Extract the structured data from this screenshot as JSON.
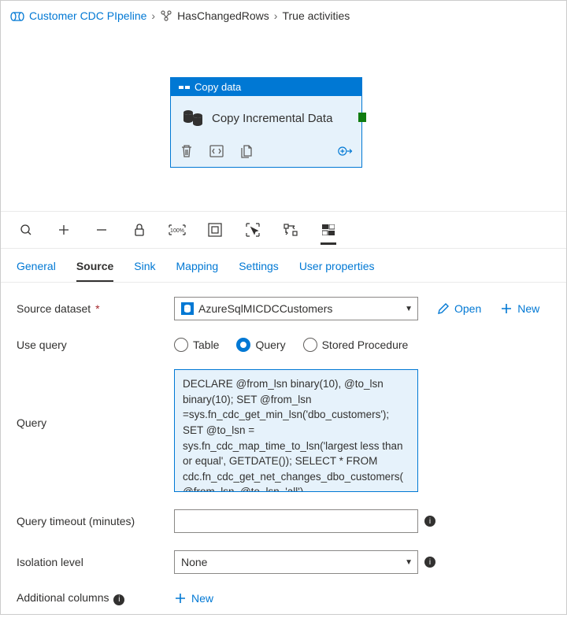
{
  "breadcrumb": {
    "root": "Customer CDC PIpeline",
    "mid": "HasChangedRows",
    "leaf": "True activities"
  },
  "activity": {
    "header": "Copy data",
    "title": "Copy Incremental Data"
  },
  "tabs": {
    "general": "General",
    "source": "Source",
    "sink": "Sink",
    "mapping": "Mapping",
    "settings": "Settings",
    "userprops": "User properties"
  },
  "form": {
    "sourceDatasetLabel": "Source dataset",
    "sourceDatasetValue": "AzureSqlMICDCCustomers",
    "openLabel": "Open",
    "newLabel": "New",
    "useQueryLabel": "Use query",
    "radioTable": "Table",
    "radioQuery": "Query",
    "radioSP": "Stored Procedure",
    "queryLabel": "Query",
    "queryValue": "DECLARE @from_lsn binary(10), @to_lsn binary(10); SET @from_lsn =sys.fn_cdc_get_min_lsn('dbo_customers'); SET @to_lsn = sys.fn_cdc_map_time_to_lsn('largest less than or equal', GETDATE()); SELECT * FROM cdc.fn_cdc_get_net_changes_dbo_customers(@from_lsn, @to_lsn, 'all')",
    "timeoutLabel": "Query timeout (minutes)",
    "isolationLabel": "Isolation level",
    "isolationValue": "None",
    "additionalLabel": "Additional columns",
    "addNewLabel": "New"
  }
}
